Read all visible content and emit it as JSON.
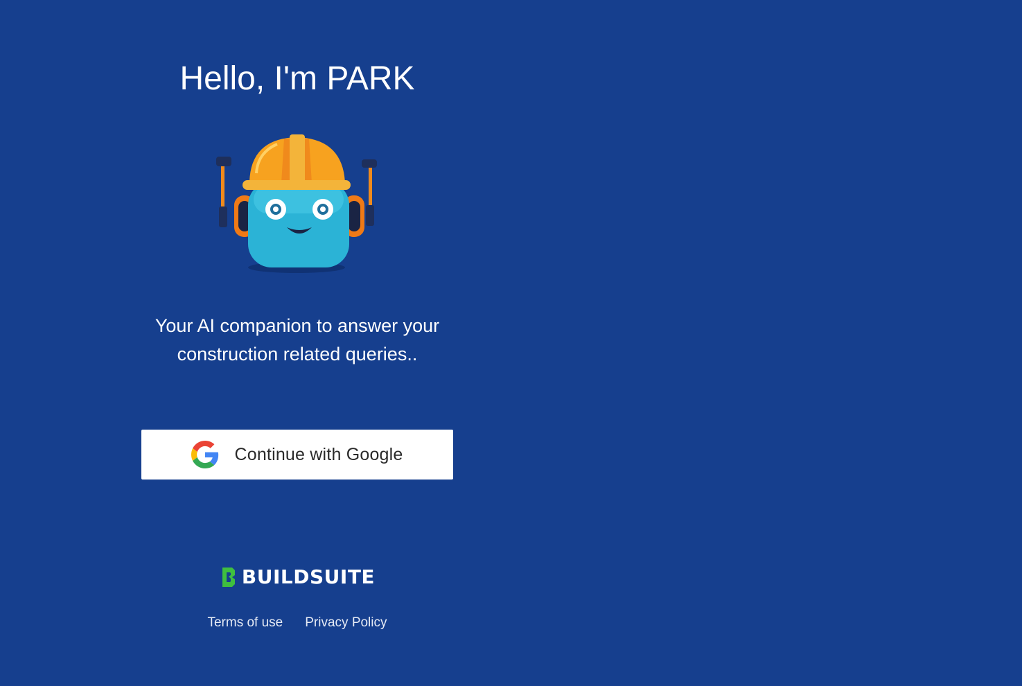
{
  "hero": {
    "title": "Hello, I'm PARK",
    "mascot": "construction-robot-mascot",
    "tagline": "Your AI companion to answer your construction related queries.."
  },
  "auth": {
    "google_button_label": "Continue with Google",
    "google_icon": "google-logo-icon"
  },
  "brand": {
    "name": "BUILDSUITE",
    "icon": "buildsuite-logo-icon",
    "icon_color": "#3fbf3f"
  },
  "footer": {
    "links": [
      {
        "label": "Terms of use"
      },
      {
        "label": "Privacy Policy"
      }
    ]
  },
  "colors": {
    "background": "#163f8e",
    "button_background": "#ffffff"
  }
}
